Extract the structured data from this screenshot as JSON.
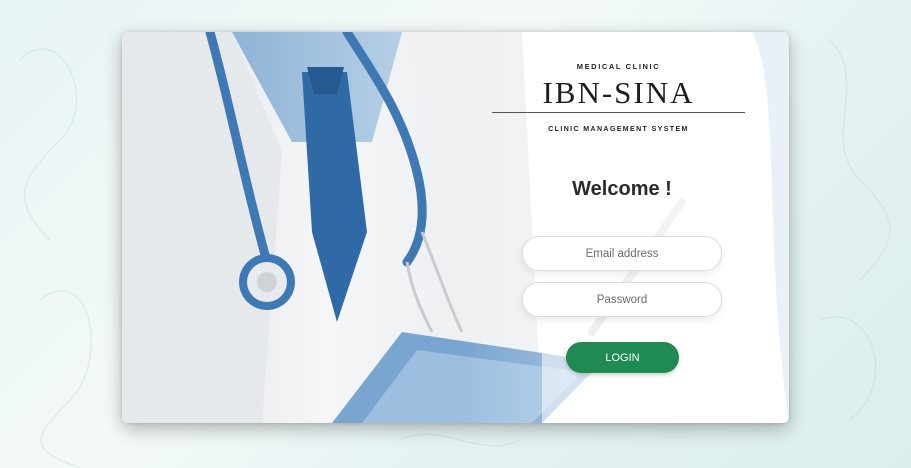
{
  "brand": {
    "top": "MEDICAL CLINIC",
    "title": "IBN-SINA",
    "subtitle": "CLINIC MANAGEMENT SYSTEM"
  },
  "login": {
    "welcome": "Welcome !",
    "email_placeholder": "Email address",
    "password_placeholder": "Password",
    "button_label": "LOGIN"
  },
  "colors": {
    "accent": "#1f8a52",
    "scrubs_blue": "#4a86bd"
  },
  "icons": [
    "stethoscope",
    "clipboard",
    "pen"
  ]
}
